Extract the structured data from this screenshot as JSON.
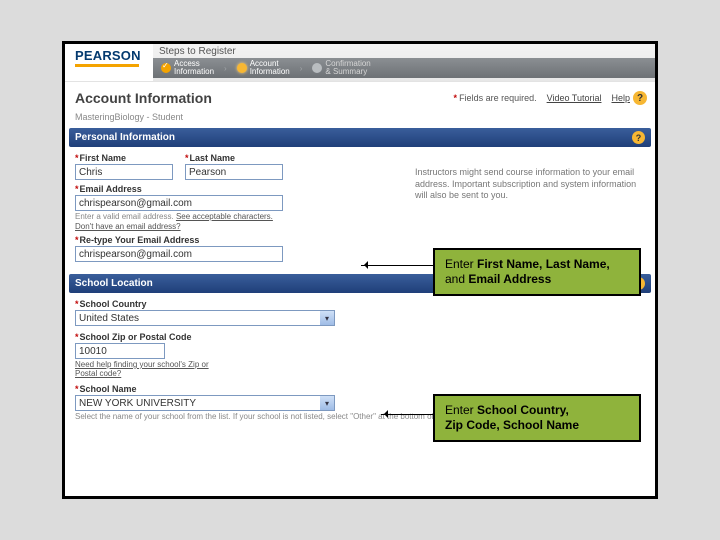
{
  "brand": "PEARSON",
  "steps_title": "Steps to Register",
  "steps": [
    {
      "label_line1": "Access",
      "label_line2": "Information"
    },
    {
      "label_line1": "Account",
      "label_line2": "Information"
    },
    {
      "label_line1": "Confirmation",
      "label_line2": "& Summary"
    }
  ],
  "page_title": "Account Information",
  "required_note": "Fields are required.",
  "video_tutorial": "Video Tutorial",
  "help_label": "Help",
  "product_subtitle": "MasteringBiology - Student",
  "band_personal": "Personal Information",
  "band_school": "School Location",
  "fields": {
    "first_name_label": "First Name",
    "first_name_value": "Chris",
    "last_name_label": "Last Name",
    "last_name_value": "Pearson",
    "email_label": "Email Address",
    "email_value": "chrispearson@gmail.com",
    "email_hint1": "Enter a valid email address.",
    "email_hint1_link": "See acceptable characters.",
    "email_hint2": "Don't have an email address?",
    "retype_label": "Re-type Your Email Address",
    "retype_value": "chrispearson@gmail.com",
    "country_label": "School Country",
    "country_value": "United States",
    "zip_label": "School Zip or Postal Code",
    "zip_value": "10010",
    "zip_hint": "Need help finding your school's Zip or Postal code?",
    "school_label": "School Name",
    "school_value": "NEW YORK UNIVERSITY",
    "school_hint": "Select the name of your school from the list. If your school is not listed, select \"Other\" at the bottom of the list."
  },
  "right_text": "Instructors might send course information to your email address. Important subscription and system information will also be sent to you.",
  "callout1_pre": "Enter ",
  "callout1_bold1": "First Name, Last Name,",
  "callout1_mid": "and ",
  "callout1_bold2": "Email Address",
  "callout2_pre": "Enter ",
  "callout2_bold1": "School Country,",
  "callout2_line2_bold": "Zip Code, School Name"
}
